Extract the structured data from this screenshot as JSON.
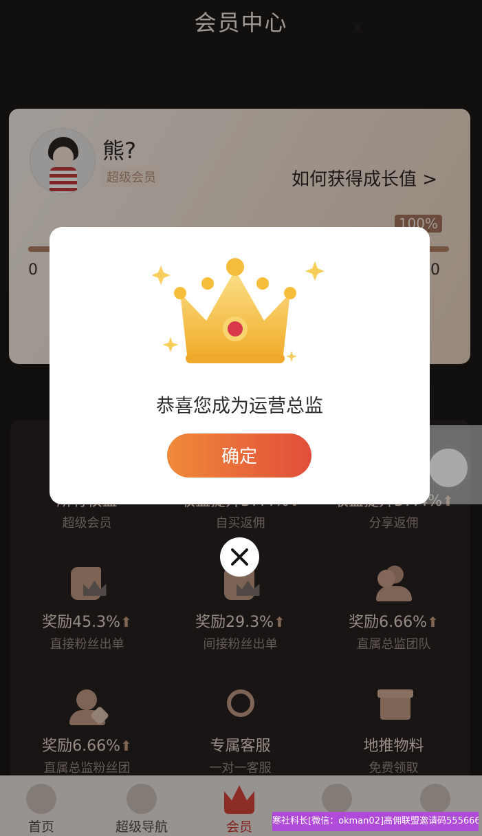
{
  "header": {
    "title": "会员中心"
  },
  "member_card": {
    "user_name": "熊?",
    "badge": "超级会员",
    "growth_link": "如何获得成长值 >",
    "progress_percent_label": "100%",
    "progress_value": 1.0,
    "progress_min": "0",
    "progress_max": "0"
  },
  "benefits": [
    {
      "title": "所有权益",
      "sub": "超级会员",
      "icon": "crown-icon"
    },
    {
      "title": "收益提升37.4%",
      "sub": "自买返佣",
      "icon": "up-arrow-icon"
    },
    {
      "title": "收益提升37.4%",
      "sub": "分享返佣",
      "icon": "up-arrow-icon"
    },
    {
      "title": "奖励45.3%",
      "sub": "直接粉丝出单",
      "icon": "scroll-crown-icon"
    },
    {
      "title": "奖励29.3%",
      "sub": "间接粉丝出单",
      "icon": "scroll-crown-icon"
    },
    {
      "title": "奖励6.66%",
      "sub": "直属总监团队",
      "icon": "team-icon"
    },
    {
      "title": "奖励6.66%",
      "sub": "直属总监粉丝团",
      "icon": "person-heart-icon"
    },
    {
      "title": "专属客服",
      "sub": "一对一客服",
      "icon": "headset-icon"
    },
    {
      "title": "地推物料",
      "sub": "免费领取",
      "icon": "box-icon"
    }
  ],
  "tabbar": [
    {
      "label": "首页",
      "icon": "home-icon",
      "active": false
    },
    {
      "label": "超级导航",
      "icon": "navigation-icon",
      "active": false
    },
    {
      "label": "会员",
      "icon": "crown-icon",
      "active": true
    },
    {
      "label": "",
      "icon": "ball-icon",
      "active": false
    },
    {
      "label": "",
      "icon": "mascot-icon",
      "active": false
    }
  ],
  "modal": {
    "message": "恭喜您成为运营总监",
    "confirm_label": "确定"
  },
  "watermark": {
    "text": "寒社科长[微信：okman02]高佣联盟邀请码555666"
  },
  "colors": {
    "accent_gradient_start": "#ef8a3a",
    "accent_gradient_end": "#e24d3a",
    "active_tab": "#c8322c"
  }
}
